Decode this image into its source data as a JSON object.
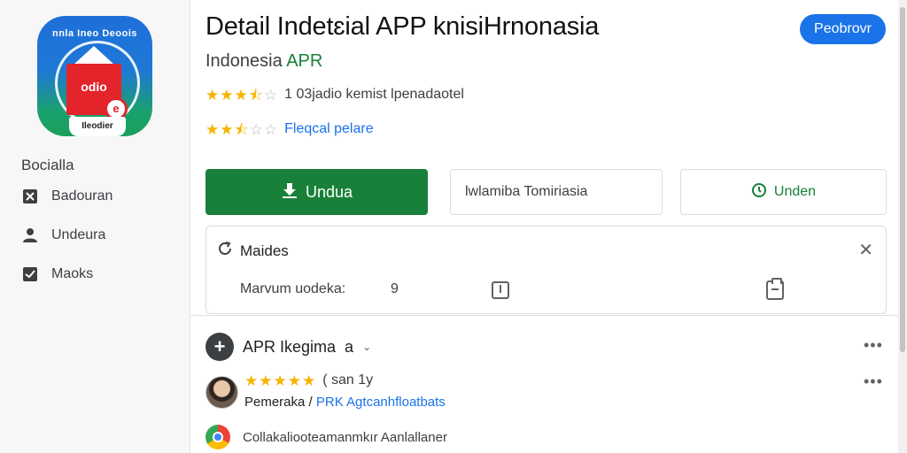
{
  "app": {
    "title": "Detail Indetɛial APP knisiHrnonasia",
    "subtitle_prefix": "Indonesia",
    "subtitle_accent": "APR",
    "top_button": "Peobrovr",
    "icon_ring_text": "nnla Ineo Deoois",
    "icon_card_text": "odio",
    "icon_bottom_text": "Ileodier",
    "icon_badge": "e"
  },
  "sidebar": {
    "heading": "Bocialla",
    "items": [
      {
        "label": "Badouran",
        "icon": "bookmark-x-icon"
      },
      {
        "label": "Undeura",
        "icon": "person-icon"
      },
      {
        "label": "Maoks",
        "icon": "check-box-icon"
      }
    ]
  },
  "ratings": [
    {
      "value": 3.5,
      "text": "1 03jadio kemist lpenadaotel",
      "style": "text"
    },
    {
      "value": 2.5,
      "text": "Fleqcal pelare",
      "style": "link"
    }
  ],
  "actions": {
    "install_label": "Undua",
    "install_icon": "download-icon",
    "middle_box_text": "lwlamiba Tomiriasia",
    "right_box_label": "Unden",
    "right_box_icon": "clock-icon"
  },
  "panel": {
    "title": "Maides",
    "title_icon": "refresh-icon",
    "row_label": "Marvum uodeka:",
    "row_value": "9",
    "close_icon": "close-icon"
  },
  "review_section": {
    "title": "APR Ikegima",
    "suffix": "a",
    "icon_glyph": "+",
    "more_label": "•••",
    "review": {
      "stars": 5,
      "meta": "( san 1y",
      "author": "Pemeraka /",
      "link_text": "PRK Agtcanhfloatbats"
    },
    "footer_text": "Collakaliooteamanmkır Aanlallaner"
  },
  "colors": {
    "accent_blue": "#1a73e8",
    "accent_green": "#188038",
    "star": "#f4b400"
  }
}
